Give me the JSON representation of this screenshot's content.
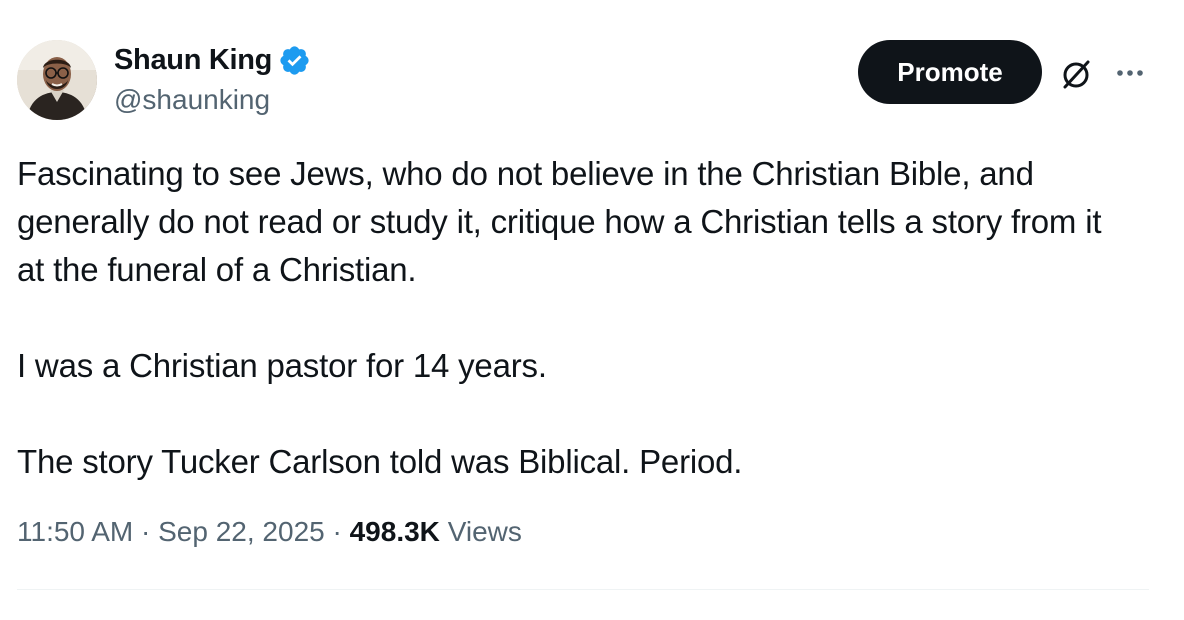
{
  "author": {
    "name": "Shaun King",
    "handle": "@shaunking",
    "verified": true,
    "verified_color": "#1d9bf0"
  },
  "header": {
    "promote_label": "Promote",
    "icons": [
      "grok-icon",
      "more-icon"
    ]
  },
  "tweet": {
    "paragraphs": [
      "Fascinating to see Jews, who do not believe in the Christian Bible, and generally do not read or study it, critique how a Christian tells a story from it at the funeral of a Christian.",
      "I was a Christian pastor for 14 years.",
      "The story Tucker Carlson told was Biblical. Period."
    ]
  },
  "meta": {
    "time": "11:50 AM",
    "separator": " · ",
    "date": "Sep 22, 2025",
    "views_count": "498.3K",
    "views_label": "Views"
  },
  "colors": {
    "text_primary": "#0f1419",
    "text_secondary": "#536471",
    "button_bg": "#0f1419",
    "divider": "#eff3f4"
  }
}
